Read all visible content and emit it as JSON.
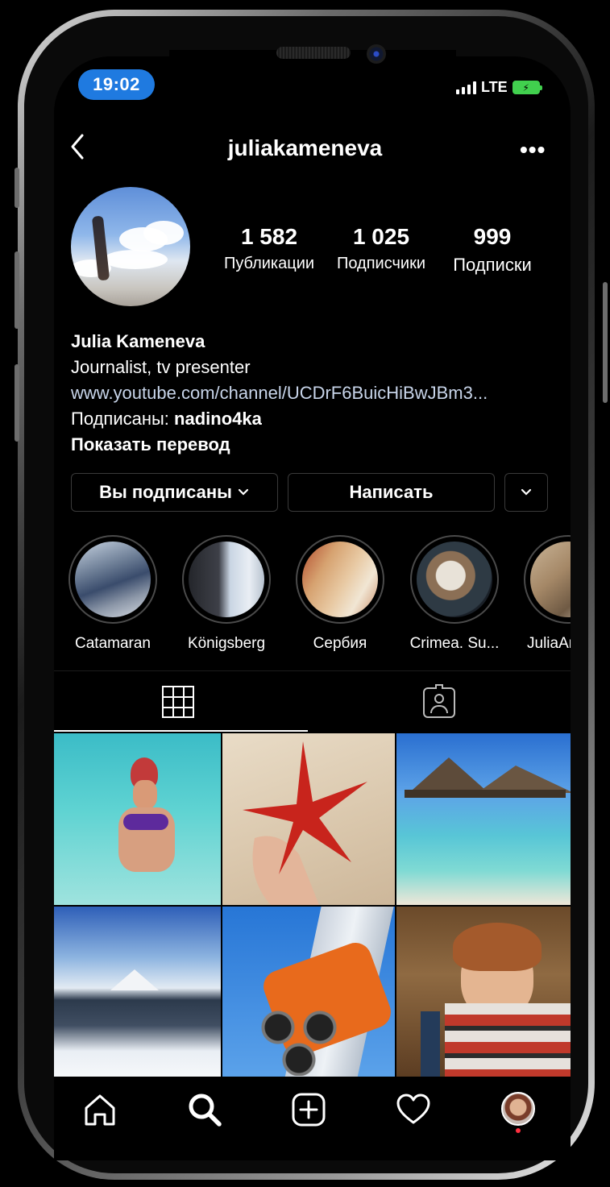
{
  "status_bar": {
    "time": "19:02",
    "network": "LTE"
  },
  "header": {
    "username": "juliakameneva",
    "back_icon": "chevron-left-icon",
    "more_icon": "more-horizontal-icon",
    "more_glyph": "•••"
  },
  "stats": [
    {
      "value": "1 582",
      "label": "Публикации"
    },
    {
      "value": "1 025",
      "label": "Подписчики"
    },
    {
      "value": "999",
      "label": "Подписки"
    }
  ],
  "bio": {
    "name": "Julia Kameneva",
    "description": "Journalist, tv presenter",
    "link": "www.youtube.com/channel/UCDrF6BuicHiBwJBm3...",
    "followed_by_prefix": "Подписаны: ",
    "followed_by_user": "nadino4ka",
    "translate": "Показать перевод"
  },
  "actions": {
    "following_label": "Вы подписаны",
    "message_label": "Написать"
  },
  "highlights": [
    {
      "label": "Catamaran"
    },
    {
      "label": "Königsberg"
    },
    {
      "label": "Сербия"
    },
    {
      "label": "Crimea. Su..."
    },
    {
      "label": "JuliaAr"
    }
  ],
  "tabs": [
    {
      "icon": "grid-icon",
      "active": true
    },
    {
      "icon": "tagged-person-icon",
      "active": false
    }
  ],
  "nav": [
    {
      "icon": "home-icon"
    },
    {
      "icon": "search-icon"
    },
    {
      "icon": "add-post-icon"
    },
    {
      "icon": "heart-icon"
    },
    {
      "icon": "profile-avatar-icon"
    }
  ],
  "colors": {
    "accent": "#1f7ae0",
    "battery": "#41d04e",
    "notification_dot": "#ff3040"
  }
}
